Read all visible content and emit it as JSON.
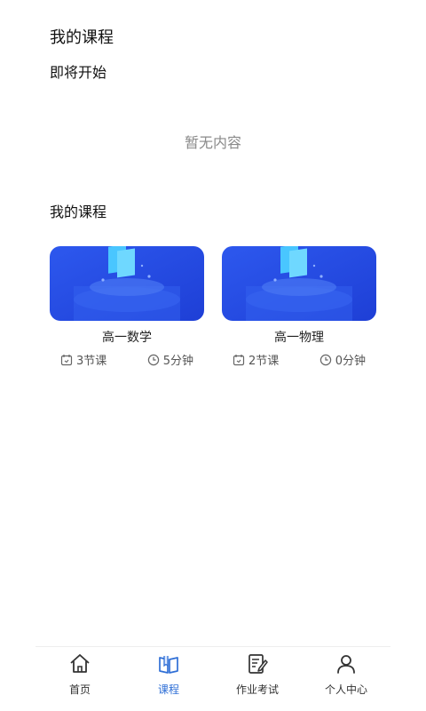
{
  "page": {
    "title": "我的课程"
  },
  "sections": {
    "upcoming": {
      "title": "即将开始",
      "empty_text": "暂无内容"
    },
    "courses": {
      "title": "我的课程"
    }
  },
  "courses": [
    {
      "name": "高一数学",
      "lessons": "3节课",
      "duration": "5分钟"
    },
    {
      "name": "高一物理",
      "lessons": "2节课",
      "duration": "0分钟"
    }
  ],
  "tabbar": {
    "items": [
      {
        "label": "首页",
        "icon": "home-icon",
        "active": false
      },
      {
        "label": "课程",
        "icon": "book-icon",
        "active": true
      },
      {
        "label": "作业考试",
        "icon": "homework-icon",
        "active": false
      },
      {
        "label": "个人中心",
        "icon": "user-icon",
        "active": false
      }
    ]
  },
  "colors": {
    "accent": "#2f6fd6",
    "card_blue": "#2a54e6",
    "muted_text": "#8a8a8a"
  }
}
